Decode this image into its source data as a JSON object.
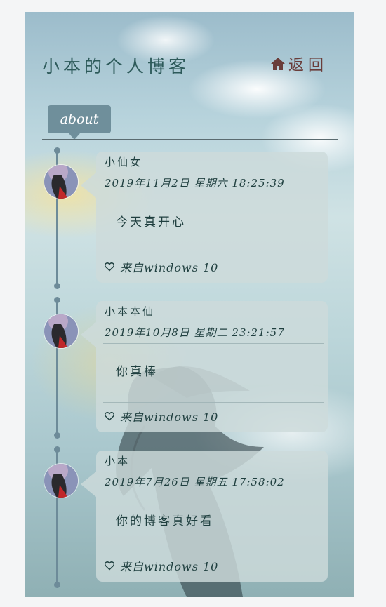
{
  "header": {
    "title": "小本的个人博客",
    "back_label": "返回"
  },
  "tab": {
    "label": "about"
  },
  "posts": [
    {
      "author": "小仙女",
      "datetime": "2019年11月2日  星期六  18:25:39",
      "content": "今天真开心",
      "source": "来自windows 10"
    },
    {
      "author": "小本本仙",
      "datetime": "2019年10月8日  星期二  23:21:57",
      "content": "你真棒",
      "source": "来自windows 10"
    },
    {
      "author": "小本",
      "datetime": "2019年7月26日  星期五  17:58:02",
      "content": "你的博客真好看",
      "source": "来自windows 10"
    }
  ],
  "colors": {
    "title": "#2d5a5a",
    "back": "#6a3d3a",
    "tab": "#6f8f9b",
    "timeline": "#6d8b99",
    "card": "#cddadb"
  },
  "icons": {
    "back": "home-icon",
    "like": "heart-icon"
  }
}
